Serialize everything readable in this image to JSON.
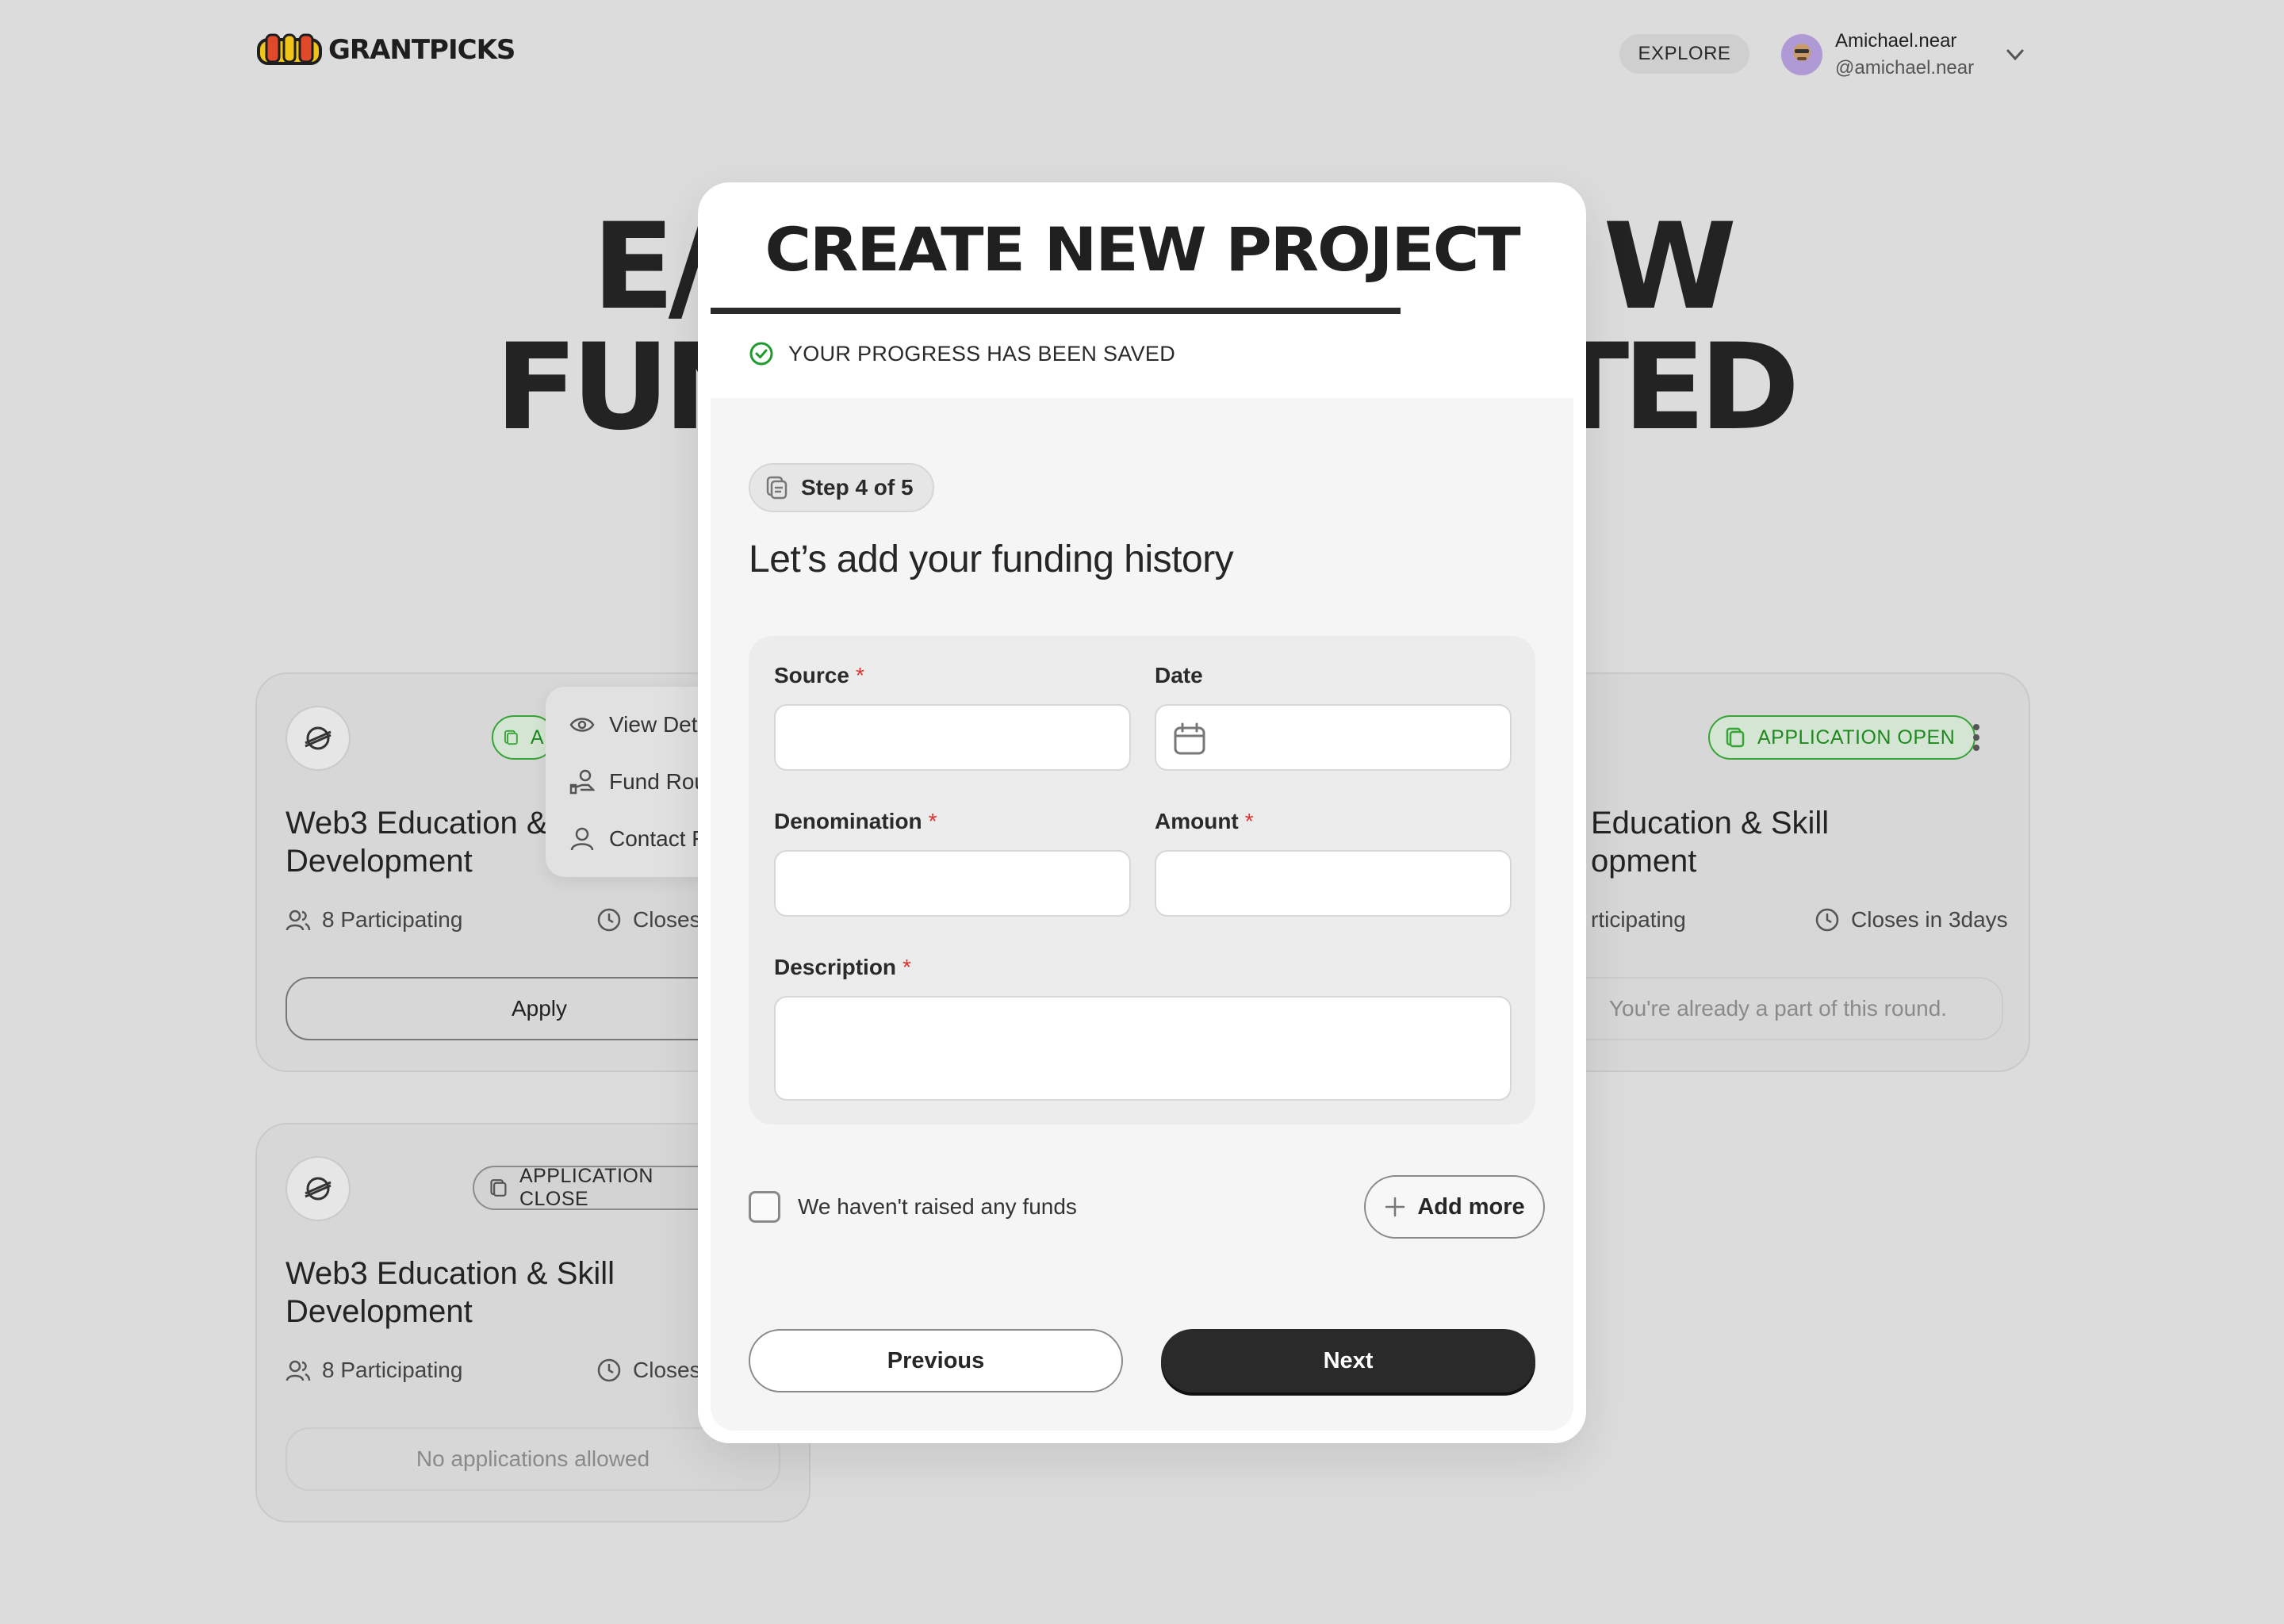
{
  "header": {
    "logo_text": "GRANTPICKS",
    "explore_label": "EXPLORE",
    "user_name": "Amichael.near",
    "user_handle": "@amichael.near"
  },
  "hero": {
    "line1_left": "E/",
    "line1_right": "W",
    "line2_left": "FUN",
    "line2_right": "TED"
  },
  "cards": [
    {
      "title_line1": "Web3 Education & S",
      "title_line2": "Development",
      "participants": "8 Participating",
      "closes": "Closes",
      "badge": "A",
      "action": "Apply"
    },
    {
      "title_line1": "Education & Skill",
      "title_line2": "opment",
      "participants": "rticipating",
      "closes": "Closes in 3days",
      "badge": "APPLICATION OPEN",
      "action": "You're already a part of this round."
    },
    {
      "title_line1": "Web3 Education & Skill",
      "title_line2": "Development",
      "participants": "8 Participating",
      "closes": "Closes",
      "badge": "APPLICATION CLOSE",
      "action": "No applications allowed"
    }
  ],
  "context_menu": {
    "items": [
      {
        "label": "View Det",
        "icon": "eye-icon"
      },
      {
        "label": "Fund Rou",
        "icon": "hand-coin-icon"
      },
      {
        "label": "Contact F",
        "icon": "person-icon"
      }
    ]
  },
  "modal": {
    "title": "CREATE NEW PROJECT",
    "progress": 0.8,
    "saved_text": "YOUR PROGRESS HAS BEEN SAVED",
    "step_label": "Step 4 of 5",
    "heading": "Let’s add your funding history",
    "fields": {
      "source_label": "Source",
      "date_label": "Date",
      "denomination_label": "Denomination",
      "amount_label": "Amount",
      "description_label": "Description",
      "required_mark": "*"
    },
    "no_funds_label": "We haven't raised any funds",
    "add_more_label": "Add more",
    "previous_label": "Previous",
    "next_label": "Next"
  },
  "colors": {
    "accent_dark": "#2a2a2a",
    "success_green": "#1f8a1f",
    "required_red": "#e0312f",
    "backdrop": "#dcdcdc"
  }
}
